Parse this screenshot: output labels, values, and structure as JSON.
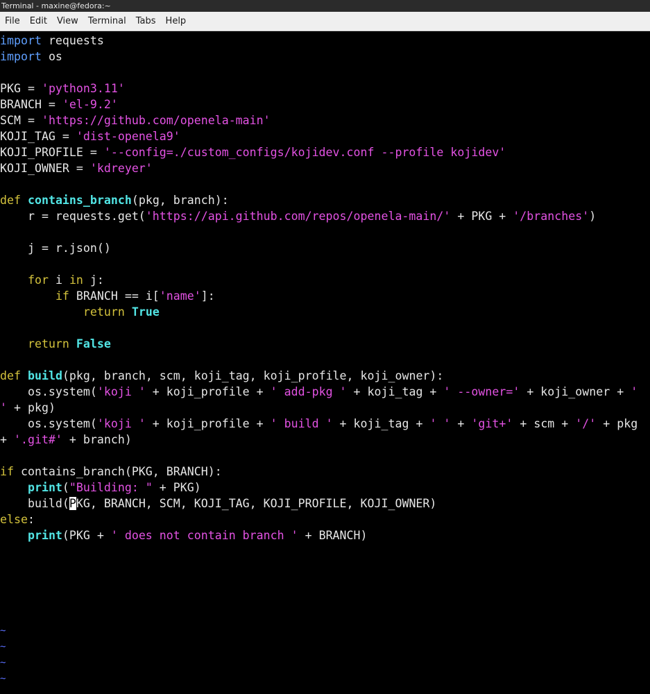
{
  "window": {
    "title": "Terminal - maxine@fedora:~"
  },
  "menu": {
    "items": [
      "File",
      "Edit",
      "View",
      "Terminal",
      "Tabs",
      "Help"
    ]
  },
  "colors": {
    "background": "#000000",
    "text": "#e6e6e6",
    "keyword": "#5f9fff",
    "control": "#d3c23c",
    "function": "#52e5e5",
    "string": "#e352e3",
    "tilde": "#5a6fff"
  },
  "code": {
    "lines": [
      [
        [
          "kw",
          "import"
        ],
        [
          "t",
          " requests"
        ]
      ],
      [
        [
          "kw",
          "import"
        ],
        [
          "t",
          " os"
        ]
      ],
      [],
      [
        [
          "t",
          "PKG = "
        ],
        [
          "str",
          "'python3.11'"
        ]
      ],
      [
        [
          "t",
          "BRANCH = "
        ],
        [
          "str",
          "'el-9.2'"
        ]
      ],
      [
        [
          "t",
          "SCM = "
        ],
        [
          "str",
          "'https://github.com/openela-main'"
        ]
      ],
      [
        [
          "t",
          "KOJI_TAG = "
        ],
        [
          "str",
          "'dist-openela9'"
        ]
      ],
      [
        [
          "t",
          "KOJI_PROFILE = "
        ],
        [
          "str",
          "'--config=./custom_configs/kojidev.conf --profile kojidev'"
        ]
      ],
      [
        [
          "t",
          "KOJI_OWNER = "
        ],
        [
          "str",
          "'kdreyer'"
        ]
      ],
      [],
      [
        [
          "ctrl",
          "def"
        ],
        [
          "t",
          " "
        ],
        [
          "fn",
          "contains_branch"
        ],
        [
          "t",
          "(pkg, branch):"
        ]
      ],
      [
        [
          "t",
          "    r = requests.get("
        ],
        [
          "str",
          "'https://api.github.com/repos/openela-main/'"
        ],
        [
          "t",
          " + PKG + "
        ],
        [
          "str",
          "'/branches'"
        ],
        [
          "t",
          ")"
        ]
      ],
      [],
      [
        [
          "t",
          "    j = r.json()"
        ]
      ],
      [],
      [
        [
          "t",
          "    "
        ],
        [
          "ctrl",
          "for"
        ],
        [
          "t",
          " i "
        ],
        [
          "ctrl",
          "in"
        ],
        [
          "t",
          " j:"
        ]
      ],
      [
        [
          "t",
          "        "
        ],
        [
          "ctrl",
          "if"
        ],
        [
          "t",
          " BRANCH == i["
        ],
        [
          "str",
          "'name'"
        ],
        [
          "t",
          "]:"
        ]
      ],
      [
        [
          "t",
          "            "
        ],
        [
          "ctrl",
          "return"
        ],
        [
          "t",
          " "
        ],
        [
          "fn",
          "True"
        ]
      ],
      [],
      [
        [
          "t",
          "    "
        ],
        [
          "ctrl",
          "return"
        ],
        [
          "t",
          " "
        ],
        [
          "fn",
          "False"
        ]
      ],
      [],
      [
        [
          "ctrl",
          "def"
        ],
        [
          "t",
          " "
        ],
        [
          "fn",
          "build"
        ],
        [
          "t",
          "(pkg, branch, scm, koji_tag, koji_profile, koji_owner):"
        ]
      ],
      [
        [
          "t",
          "    os.system("
        ],
        [
          "str",
          "'koji '"
        ],
        [
          "t",
          " + koji_profile + "
        ],
        [
          "str",
          "' add-pkg '"
        ],
        [
          "t",
          " + koji_tag + "
        ],
        [
          "str",
          "' --owner='"
        ],
        [
          "t",
          " + koji_owner + "
        ],
        [
          "str",
          "'"
        ]
      ],
      [
        [
          "str",
          "'"
        ],
        [
          "t",
          " + pkg)"
        ]
      ],
      [
        [
          "t",
          "    os.system("
        ],
        [
          "str",
          "'koji '"
        ],
        [
          "t",
          " + koji_profile + "
        ],
        [
          "str",
          "' build '"
        ],
        [
          "t",
          " + koji_tag + "
        ],
        [
          "str",
          "' '"
        ],
        [
          "t",
          " + "
        ],
        [
          "str",
          "'git+'"
        ],
        [
          "t",
          " + scm + "
        ],
        [
          "str",
          "'/'"
        ],
        [
          "t",
          " + pkg"
        ]
      ],
      [
        [
          "t",
          "+ "
        ],
        [
          "str",
          "'.git#'"
        ],
        [
          "t",
          " + branch)"
        ]
      ],
      [],
      [
        [
          "ctrl",
          "if"
        ],
        [
          "t",
          " contains_branch(PKG, BRANCH):"
        ]
      ],
      [
        [
          "t",
          "    "
        ],
        [
          "fn",
          "print"
        ],
        [
          "t",
          "("
        ],
        [
          "str",
          "\"Building: \""
        ],
        [
          "t",
          " + PKG)"
        ]
      ],
      [
        [
          "t",
          "    build("
        ],
        [
          "cur",
          "P"
        ],
        [
          "t",
          "KG, BRANCH, SCM, KOJI_TAG, KOJI_PROFILE, KOJI_OWNER)"
        ]
      ],
      [
        [
          "ctrl",
          "else"
        ],
        [
          "t",
          ":"
        ]
      ],
      [
        [
          "t",
          "    "
        ],
        [
          "fn",
          "print"
        ],
        [
          "t",
          "(PKG + "
        ],
        [
          "str",
          "' does not contain branch '"
        ],
        [
          "t",
          " + BRANCH)"
        ]
      ]
    ],
    "tildes": [
      "~",
      "~",
      "~",
      "~"
    ]
  }
}
